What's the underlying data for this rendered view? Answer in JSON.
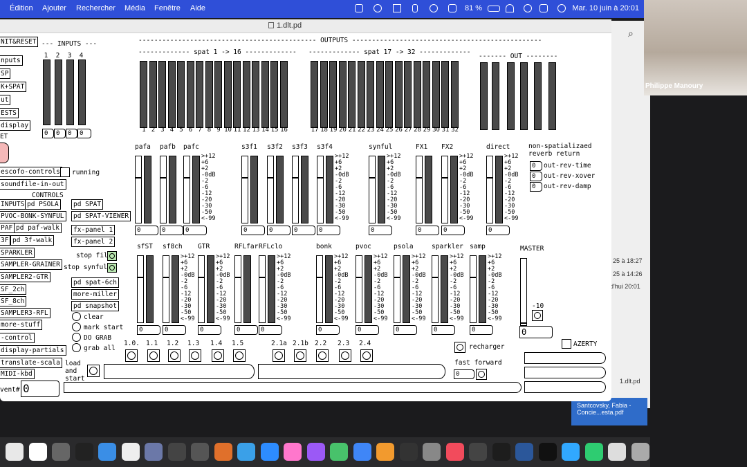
{
  "menubar": {
    "items": [
      "Édition",
      "Ajouter",
      "Rechercher",
      "Média",
      "Fenêtre",
      "Aide"
    ],
    "battery": "81 %",
    "clock": "Mar. 10 juin à 20:01"
  },
  "window": {
    "title": "1.dlt.pd"
  },
  "inputs": {
    "title": "--- INPUTS ---",
    "nums": [
      "1",
      "2",
      "3",
      "4"
    ],
    "boxes": [
      "0",
      "0",
      "0",
      "0"
    ]
  },
  "outputs": {
    "title": "--------------------------------------------- OUTPUTS ------------------------------------------------",
    "spat1": "------------- spat 1 -> 16 -------------",
    "spat1_nums": [
      "1",
      "2",
      "3",
      "4",
      "5",
      "6",
      "7",
      "8",
      "9",
      "10",
      "11",
      "12",
      "13",
      "14",
      "15",
      "16"
    ],
    "spat2": "------------- spat 17 -> 32 -------------",
    "spat2_nums": [
      "17",
      "18",
      "19",
      "20",
      "21",
      "22",
      "23",
      "24",
      "25",
      "26",
      "27",
      "28",
      "29",
      "30",
      "31",
      "32"
    ],
    "out": "------- OUT --------"
  },
  "left_objects": [
    "NIT&RESET",
    "nputs",
    "SP",
    "K+SPAT",
    "ut",
    "ESTS",
    "display",
    "ET",
    "escofo-controls",
    "soundfile-in-out",
    "INPUTS",
    "PVOC-BONK-SYNFUL",
    "PAF",
    "3F",
    "SPARKLER",
    "SAMPLER-GRAINER",
    "SAMPLER2-GTR",
    "SF_2ch",
    "SF_8ch",
    "SAMPLER3-RFL",
    "more-stuff",
    "-control",
    "display-partials",
    "translate-scala",
    "MIDI-kbd",
    "vent#"
  ],
  "center_objects": [
    "pd PSOLA",
    "pd paf-walk",
    "pd 3f-walk",
    "pd SPAT",
    "pd SPAT-VIEWER",
    "fx-panel 1",
    "fx-panel 2",
    "pd spat-6ch",
    "more-miller",
    "pd snapshot"
  ],
  "labels": {
    "running": "running",
    "controls": "CONTROLS",
    "stop_files": "stop files",
    "stop_synful": "stop synful",
    "clear": "clear",
    "mark_start": "mark start",
    "do_grab": "DO GRAB",
    "grab_all": "grab all",
    "load_start": "load\nand\nstart",
    "recharger": "recharger",
    "fast_forward": "fast forward",
    "azerty": "AZERTY",
    "master": "MASTER",
    "master_val": "-10",
    "nonspat": "non-spatializaed\nreverb return",
    "rev": [
      "out-rev-time",
      "out-rev-xover",
      "out-rev-damp"
    ],
    "event_val": "0"
  },
  "row1": [
    "pafa",
    "pafb",
    "pafc",
    "s3f1",
    "s3f2",
    "s3f3",
    "s3f4",
    "synful",
    "FX1",
    "FX2",
    "direct"
  ],
  "row2": [
    "sfST",
    "sf8ch",
    "GTR",
    "RFLfar",
    "RFLclo",
    "bonk",
    "pvoc",
    "psola",
    "sparkler",
    "samp"
  ],
  "meter_scale": ">+12\n+6\n+2\n-0dB\n-2\n-6\n-12\n-20\n-30\n-50\n<-99",
  "cues": [
    "1.0.",
    "1.1",
    "1.2",
    "1.3",
    "1.4",
    "1.5",
    "2.1a",
    "2.1b",
    "2.2",
    "2.3",
    "2.4"
  ],
  "video": {
    "name": "Philippe Manoury"
  },
  "side": {
    "dates": [
      "25 à 18:27",
      "25 à 14:26",
      "d'hui 20:01"
    ],
    "file": "1.dlt.pd",
    "pdf": "Santcovsky, Fabia - Concie...esta.pdf"
  },
  "colors": {
    "menubar": "#2f4fd8",
    "meter": "#4a4a4a",
    "toggle_on": "#b9e7b0",
    "bang_pink": "#f5b8b8"
  }
}
